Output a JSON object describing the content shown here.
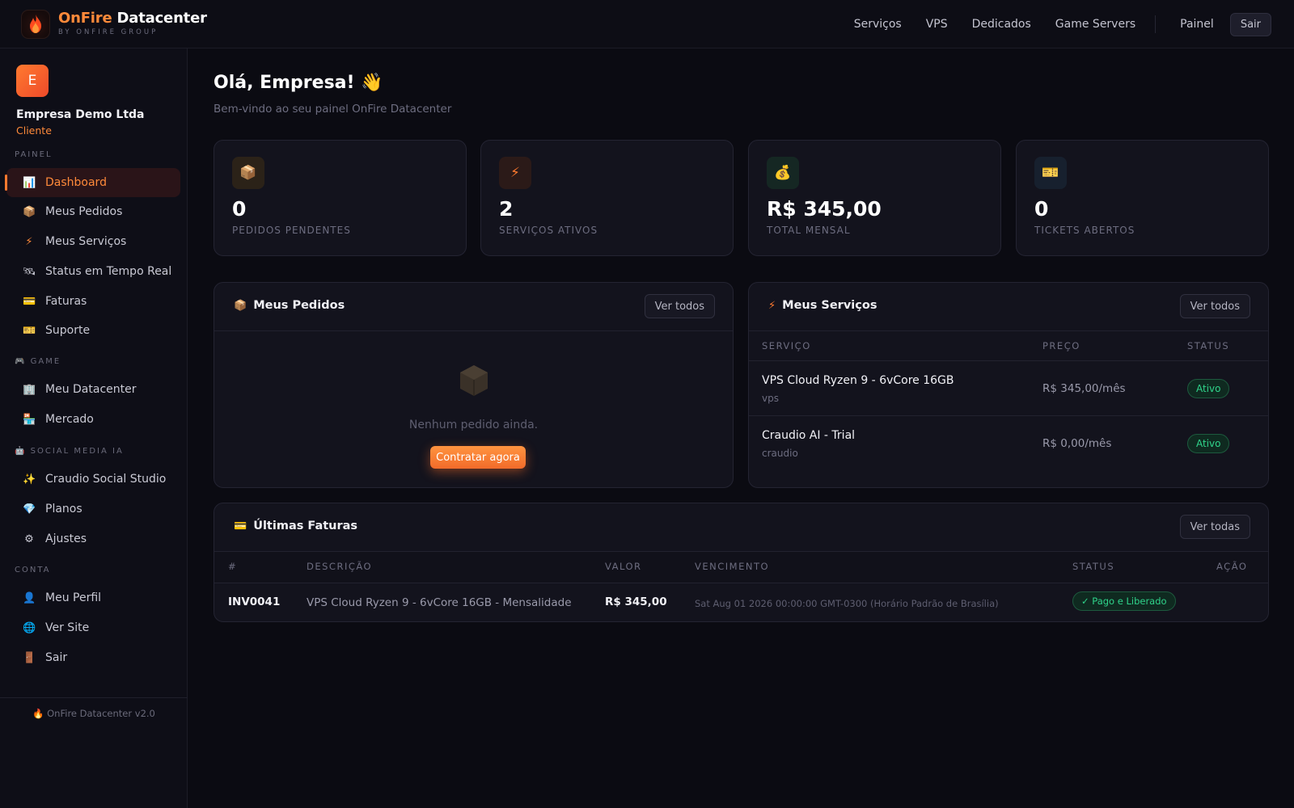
{
  "nav": {
    "brand_accent": "OnFire",
    "brand_rest": "Datacenter",
    "brand_sub": "BY ONFIRE GROUP",
    "links": [
      "Serviços",
      "VPS",
      "Dedicados",
      "Game Servers"
    ],
    "painel": "Painel",
    "sair": "Sair"
  },
  "sidebar": {
    "avatar_letter": "E",
    "user_name": "Empresa Demo Ltda",
    "user_role": "Cliente",
    "sections": {
      "painel": "PAINEL",
      "game": "GAME",
      "social": "SOCIAL MEDIA IA",
      "conta": "CONTA"
    },
    "items": [
      {
        "label": "Dashboard",
        "icon": "📊"
      },
      {
        "label": "Meus Pedidos",
        "icon": "📦"
      },
      {
        "label": "Meus Serviços",
        "icon": "⚡"
      },
      {
        "label": "Status em Tempo Real",
        "icon": "🛰"
      },
      {
        "label": "Faturas",
        "icon": "💳"
      },
      {
        "label": "Suporte",
        "icon": "🎫"
      },
      {
        "label": "Meu Datacenter",
        "icon": "🏢"
      },
      {
        "label": "Mercado",
        "icon": "🏪"
      },
      {
        "label": "Craudio Social Studio",
        "icon": "✨"
      },
      {
        "label": "Planos",
        "icon": "💎"
      },
      {
        "label": "Ajustes",
        "icon": "⚙"
      },
      {
        "label": "Meu Perfil",
        "icon": "👤"
      },
      {
        "label": "Ver Site",
        "icon": "🌐"
      },
      {
        "label": "Sair",
        "icon": "🚪"
      }
    ],
    "footer": "OnFire Datacenter v2.0"
  },
  "main": {
    "greeting": "Olá, Empresa! 👋",
    "subtitle": "Bem-vindo ao seu painel OnFire Datacenter",
    "stats": [
      {
        "value": "0",
        "label": "PEDIDOS PENDENTES",
        "icon": "📦"
      },
      {
        "value": "2",
        "label": "SERVIÇOS ATIVOS",
        "icon": "⚡"
      },
      {
        "value": "R$ 345,00",
        "label": "TOTAL MENSAL",
        "icon": "💰"
      },
      {
        "value": "0",
        "label": "TICKETS ABERTOS",
        "icon": "🎫"
      }
    ],
    "orders": {
      "title": "Meus Pedidos",
      "view_all": "Ver todos",
      "empty": "Nenhum pedido ainda.",
      "cta": "Contratar agora"
    },
    "services": {
      "title": "Meus Serviços",
      "view_all": "Ver todos",
      "headers": [
        "SERVIÇO",
        "PREÇO",
        "STATUS"
      ],
      "rows": [
        {
          "name": "VPS Cloud Ryzen 9 - 6vCore 16GB",
          "type": "vps",
          "price": "R$ 345,00/mês",
          "status": "Ativo"
        },
        {
          "name": "Craudio AI - Trial",
          "type": "craudio",
          "price": "R$ 0,00/mês",
          "status": "Ativo"
        }
      ]
    },
    "invoices": {
      "title": "Últimas Faturas",
      "view_all": "Ver todas",
      "headers": [
        "#",
        "DESCRIÇÃO",
        "VALOR",
        "VENCIMENTO",
        "STATUS",
        "AÇÃO"
      ],
      "rows": [
        {
          "id": "INV0041",
          "desc": "VPS Cloud Ryzen 9 - 6vCore 16GB - Mensalidade",
          "value": "R$ 345,00",
          "due": "Sat Aug 01 2026 00:00:00 GMT-0300 (Horário Padrão de Brasília)",
          "status": "✓ Pago e Liberado"
        }
      ]
    }
  },
  "colors": {
    "accent": "#ff8a3a",
    "success": "#2fd38a",
    "background": "#0b0b12",
    "card": "#13131d"
  }
}
